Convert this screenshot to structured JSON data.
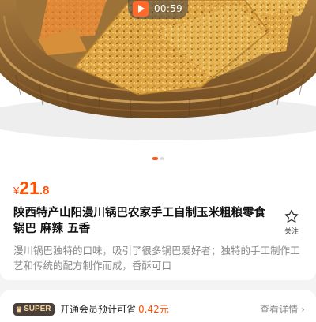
{
  "video": {
    "duration": "00:59",
    "icon": "play-icon",
    "accent": "#ff6a2a"
  },
  "gallery": {
    "page_count": 2,
    "active_index": 0
  },
  "product": {
    "price": {
      "currency": "¥",
      "integer": "21",
      "decimal": ".8",
      "color": "#ff5000"
    },
    "title": "陕西特产山阳漫川锅巴农家手工自制玉米粗粮零食锅巴 麻辣 五香",
    "favorite": {
      "label": "关注",
      "icon": "star-outline-icon"
    },
    "description": "漫川锅巴独特的口味，吸引了很多锅巴爱好者；独特的手工制作工艺和传统的配方制作而成，香酥可口"
  },
  "membership": {
    "badge": "SUPER",
    "badge_icon": "crown-icon",
    "text": "开通会员预计可省",
    "amount": "0.42元",
    "link_label": "查看详情",
    "link_icon": "chevron-right-icon"
  }
}
